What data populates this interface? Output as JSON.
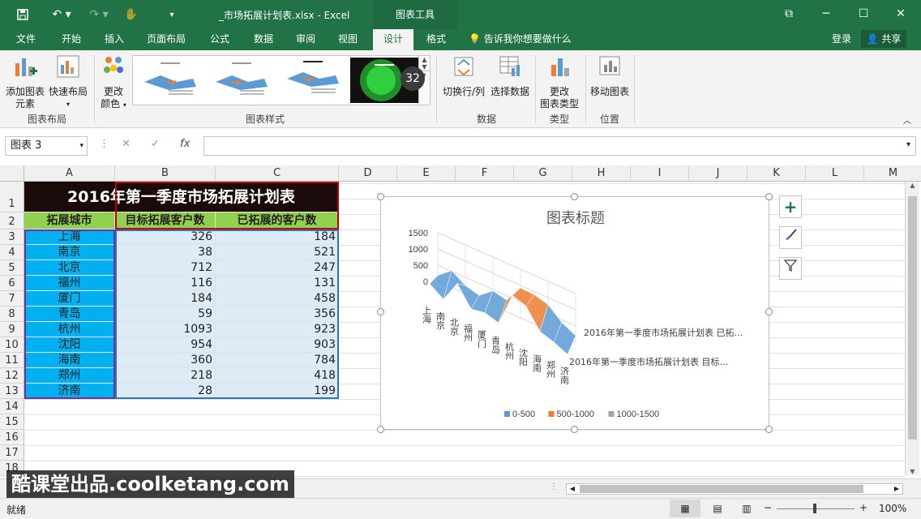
{
  "titlebar": {
    "doc_title": "_市场拓展计划表.xlsx - Excel",
    "context_tab": "图表工具"
  },
  "tabs": [
    {
      "label": "文件"
    },
    {
      "label": "开始"
    },
    {
      "label": "插入"
    },
    {
      "label": "页面布局"
    },
    {
      "label": "公式"
    },
    {
      "label": "数据"
    },
    {
      "label": "审阅"
    },
    {
      "label": "视图"
    },
    {
      "label": "设计"
    },
    {
      "label": "格式"
    }
  ],
  "tell_me": "告诉我你想要做什么",
  "account": {
    "login": "登录",
    "share": "共享"
  },
  "ribbon": {
    "add_element_1": "添加图表",
    "add_element_2": "元素",
    "quick_layout": "快速布局",
    "change_color_1": "更改",
    "change_color_2": "颜色",
    "switch_rowcol": "切换行/列",
    "select_data": "选择数据",
    "change_type_1": "更改",
    "change_type_2": "图表类型",
    "move_chart": "移动图表",
    "groups": {
      "layout": "图表布局",
      "styles": "图表样式",
      "data": "数据",
      "type": "类型",
      "location": "位置"
    },
    "badge": "32"
  },
  "formula_bar": {
    "name_box": "图表 3",
    "fx": "fx",
    "formula": ""
  },
  "columns": [
    "A",
    "B",
    "C",
    "D",
    "E",
    "F",
    "G",
    "H",
    "I",
    "J",
    "K",
    "L",
    "M"
  ],
  "rows": [
    "1",
    "2",
    "3",
    "4",
    "5",
    "6",
    "7",
    "8",
    "9",
    "10",
    "11",
    "12",
    "13",
    "14",
    "15",
    "16",
    "17",
    "18"
  ],
  "sheet": {
    "title": "2016年第一季度市场拓展计划表",
    "headers": [
      "拓展城市",
      "目标拓展客户数",
      "已拓展的客户数"
    ],
    "data": [
      [
        "上海",
        "326",
        "184"
      ],
      [
        "南京",
        "38",
        "521"
      ],
      [
        "北京",
        "712",
        "247"
      ],
      [
        "福州",
        "116",
        "131"
      ],
      [
        "厦门",
        "184",
        "458"
      ],
      [
        "青岛",
        "59",
        "356"
      ],
      [
        "杭州",
        "1093",
        "923"
      ],
      [
        "沈阳",
        "954",
        "903"
      ],
      [
        "海南",
        "360",
        "784"
      ],
      [
        "郑州",
        "218",
        "418"
      ],
      [
        "济南",
        "28",
        "199"
      ]
    ]
  },
  "chart_data": {
    "type": "surface",
    "title": "图表标题",
    "categories": [
      "上海",
      "南京",
      "北京",
      "福州",
      "厦门",
      "青岛",
      "杭州",
      "沈阳",
      "海南",
      "郑州",
      "济南"
    ],
    "series": [
      {
        "name": "2016年第一季度市场拓展计划表 已拓…",
        "values": [
          184,
          521,
          247,
          131,
          458,
          356,
          923,
          903,
          784,
          418,
          199
        ]
      },
      {
        "name": "2016年第一季度市场拓展计划表 目标…",
        "values": [
          326,
          38,
          712,
          116,
          184,
          59,
          1093,
          954,
          360,
          218,
          28
        ]
      }
    ],
    "z_ticks": [
      "1500",
      "1000",
      "500",
      "0"
    ],
    "zlim": [
      0,
      1500
    ],
    "legend": [
      {
        "label": "0-500",
        "color": "#5b9bd5"
      },
      {
        "label": "500-1000",
        "color": "#ed7d31"
      },
      {
        "label": "1000-1500",
        "color": "#a5a5a5"
      }
    ],
    "legend_position": "bottom"
  },
  "status": {
    "ready": "就绪",
    "zoom": "100%"
  },
  "watermark": "酷课堂出品.coolketang.com",
  "colors": {
    "accent": "#217346",
    "title_bg": "#1a0a0a",
    "header_bg": "#92d050",
    "city_bg": "#00b0f0",
    "value_bg": "#ddebf7"
  }
}
